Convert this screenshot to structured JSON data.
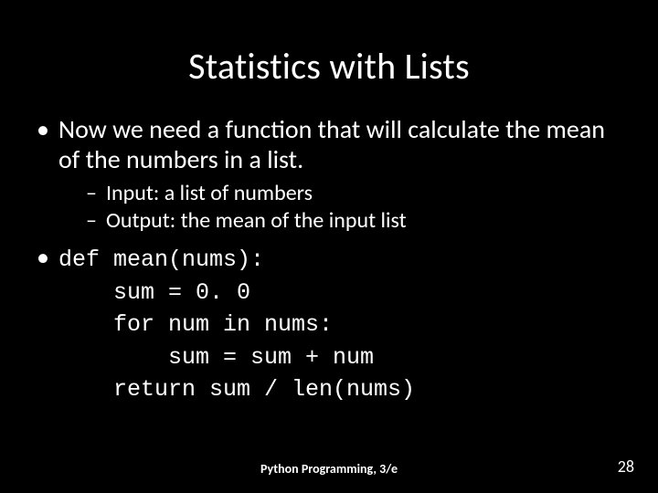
{
  "title": "Statistics with Lists",
  "bullets": {
    "b1": "Now we need a function that will calculate the mean of the numbers in a list.",
    "b1a": "Input: a list of numbers",
    "b1b": "Output: the mean of the input list",
    "code": "def mean(nums):\n    sum = 0. 0\n    for num in nums:\n        sum = sum + num\n    return sum / len(nums)"
  },
  "footer": {
    "center": "Python Programming, 3/e",
    "page": "28"
  }
}
